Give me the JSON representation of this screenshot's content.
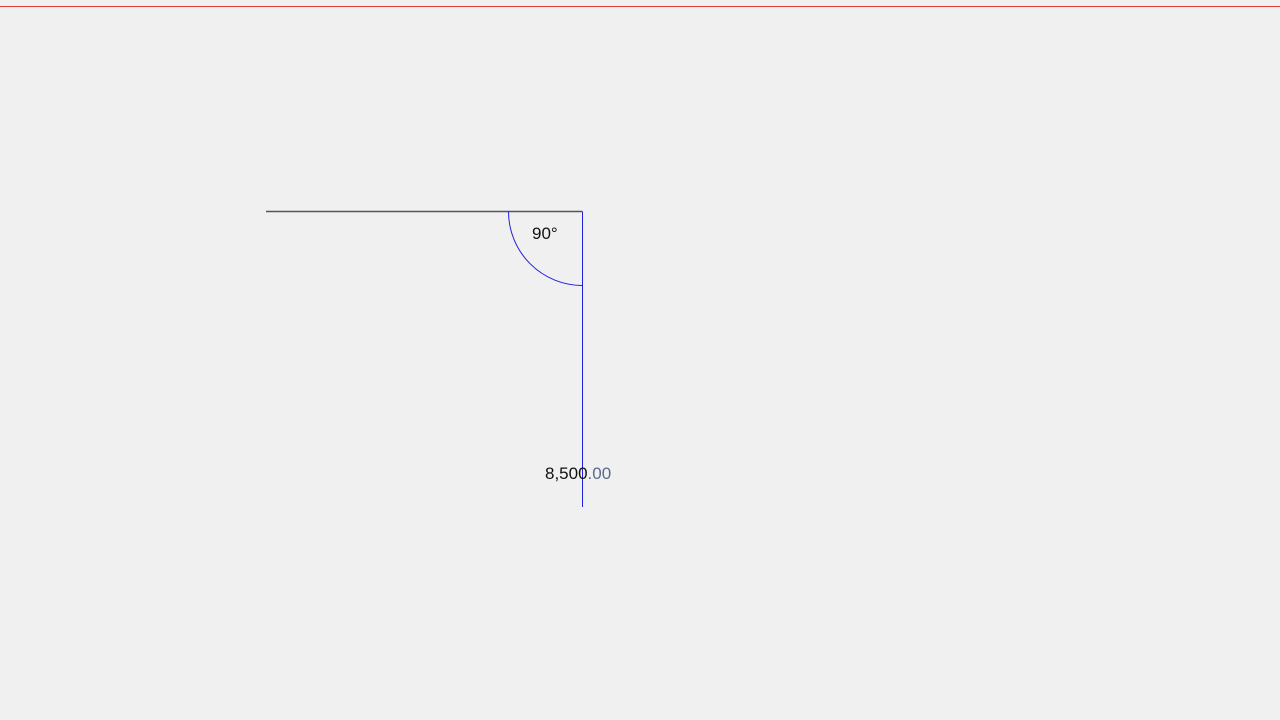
{
  "drawing": {
    "angle_label": "90°",
    "length_label": {
      "integer_part": "8,500",
      "decimal_part": ".00"
    }
  },
  "colors": {
    "background": "#f0f0f0",
    "top_guide_line": "#e03a3a",
    "existing_line": "#555555",
    "active_line": "#2020e0",
    "arc": "#2020e0",
    "text": "#111111",
    "decimal_text": "#5a6a8a"
  }
}
